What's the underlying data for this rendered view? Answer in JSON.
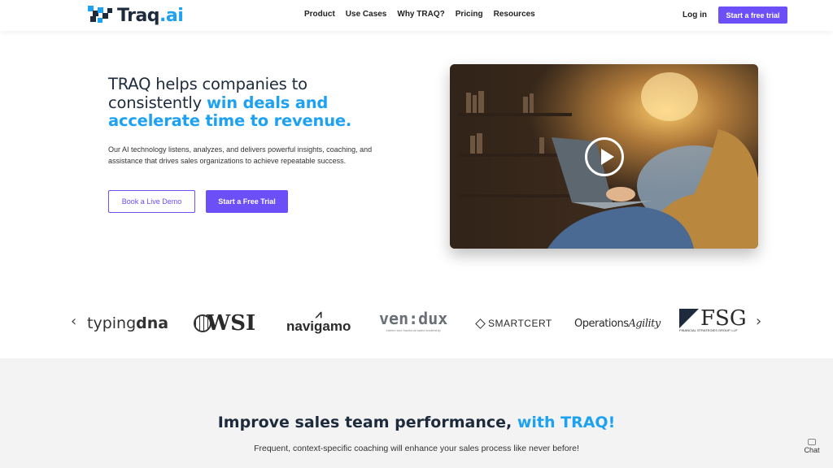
{
  "brand": {
    "logo_text_a": "Traq",
    "logo_text_b": ".ai",
    "accent_color": "#1da1f2",
    "primary_color": "#6c4ff6"
  },
  "nav": {
    "items": [
      "Product",
      "Use Cases",
      "Why TRAQ?",
      "Pricing",
      "Resources"
    ],
    "login": "Log in",
    "cta": "Start a free trial"
  },
  "hero": {
    "title_plain": "TRAQ helps companies to consistently ",
    "title_accent_1": "win deals and",
    "title_accent_2": "accelerate time to revenue.",
    "description": "Our AI technology listens, analyzes, and delivers powerful insights, coaching, and assistance that drives sales organizations to achieve repeatable success.",
    "button_demo": "Book a Live Demo",
    "button_trial": "Start a Free Trial",
    "video_icon": "play-icon"
  },
  "logos": {
    "typingdna_a": "typing",
    "typingdna_b": "dna",
    "wsi": "WSI",
    "navigamo": "navigamo",
    "vendux": "ven:dux",
    "vendux_tagline": "interim and fractional sales leadership",
    "smartcert": "SMARTCERT",
    "ops_a": "Operations",
    "ops_b": "Agility",
    "fsg": "FSG",
    "fsg_tagline": "FINANCIAL STRATEGIES GROUP, LLP",
    "prev_icon": "chevron-left-icon",
    "next_icon": "chevron-right-icon"
  },
  "section2": {
    "title_plain": "Improve sales team performance, ",
    "title_accent": "with TRAQ!",
    "subtitle": "Frequent, context-specific coaching will enhance your sales process like never before!"
  },
  "chat": {
    "label": "Chat",
    "icon": "chat-icon"
  }
}
